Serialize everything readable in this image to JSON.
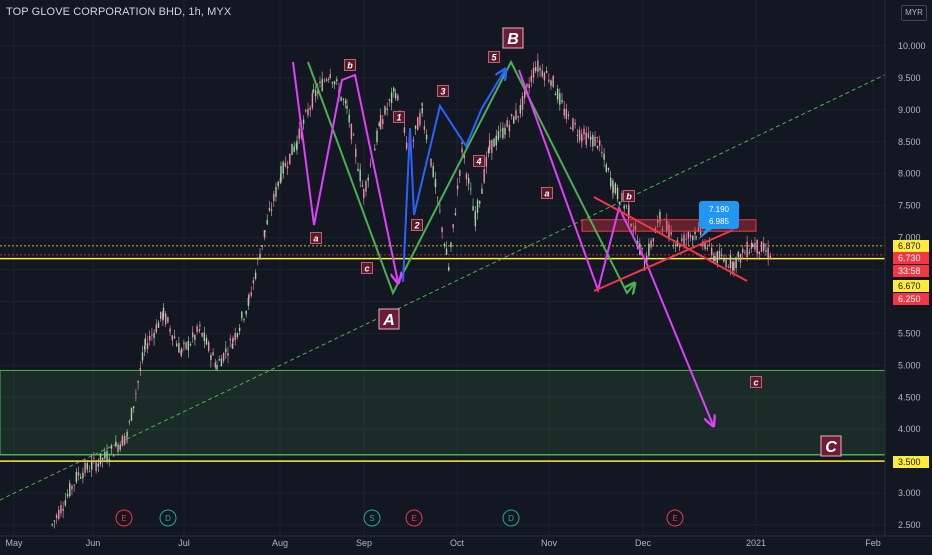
{
  "header": {
    "symbol_line": "TOP GLOVE CORPORATION BHD, 1h, MYX",
    "currency": "MYR"
  },
  "colors": {
    "background": "#131722",
    "candle_up": "#a5d6a7",
    "candle_down": "#f48fb1",
    "magenta": "#e040fb",
    "green": "#4caf50",
    "blue": "#2962ff",
    "red": "#f23645",
    "yellow": "#ffeb3b"
  },
  "chart_data": {
    "type": "candlestick",
    "x_tick_labels": [
      "May",
      "Jun",
      "Jul",
      "Aug",
      "Sep",
      "Oct",
      "Nov",
      "Dec",
      "2021",
      "Feb"
    ],
    "y_tick_labels": [
      "10.000",
      "9.500",
      "9.000",
      "8.500",
      "8.000",
      "7.500",
      "7.000",
      "6.500",
      "6.000",
      "5.500",
      "5.000",
      "4.500",
      "4.000",
      "3.500",
      "3.000",
      "2.500"
    ],
    "y_range": [
      2.5,
      10.0
    ],
    "price_path": [
      [
        "May",
        2.5
      ],
      [
        "May",
        3.3
      ],
      [
        "May",
        3.55
      ],
      [
        "Jun",
        3.9
      ],
      [
        "Jun",
        5.3
      ],
      [
        "Jun",
        5.8
      ],
      [
        "Jun",
        5.2
      ],
      [
        "Jun",
        5.55
      ],
      [
        "Jul",
        5.0
      ],
      [
        "Jul",
        5.4
      ],
      [
        "Jul",
        6.0
      ],
      [
        "Jul",
        7.1
      ],
      [
        "Jul",
        8.0
      ],
      [
        "Jul",
        8.5
      ],
      [
        "Aug",
        9.2
      ],
      [
        "Aug",
        9.6
      ],
      [
        "Aug",
        9.0
      ],
      [
        "Aug",
        7.7
      ],
      [
        "Aug",
        8.8
      ],
      [
        "Sep",
        9.3
      ],
      [
        "Sep",
        8.3
      ],
      [
        "Sep",
        9.0
      ],
      [
        "Sep",
        7.8
      ],
      [
        "Sep",
        6.5
      ],
      [
        "Sep",
        8.4
      ],
      [
        "Sep",
        7.3
      ],
      [
        "Oct",
        8.4
      ],
      [
        "Oct",
        8.7
      ],
      [
        "Oct",
        9.0
      ],
      [
        "Oct",
        9.7
      ],
      [
        "Oct",
        9.5
      ],
      [
        "Oct",
        8.9
      ],
      [
        "Nov",
        8.6
      ],
      [
        "Nov",
        8.5
      ],
      [
        "Nov",
        7.8
      ],
      [
        "Nov",
        7.4
      ],
      [
        "Nov",
        6.6
      ],
      [
        "Nov",
        7.3
      ],
      [
        "Dec",
        6.9
      ],
      [
        "Dec",
        7.1
      ],
      [
        "Dec",
        6.7
      ],
      [
        "Dec",
        6.6
      ],
      [
        "Dec",
        6.9
      ],
      [
        "Dec",
        6.73
      ]
    ],
    "last_price_label": "6.730",
    "countdown_label": "33:58",
    "price_level_labels": [
      {
        "text": "6.870",
        "bg": "#ffeb3b",
        "fg": "#131722",
        "value": 6.87
      },
      {
        "text": "6.730",
        "bg": "#f23645",
        "fg": "#ffffff",
        "value": 6.73
      },
      {
        "text": "6.670",
        "bg": "#ffeb3b",
        "fg": "#131722",
        "value": 6.67
      },
      {
        "text": "6.250",
        "bg": "#f23645",
        "fg": "#ffffff",
        "value": 6.25
      },
      {
        "text": "3.500",
        "bg": "#ffeb3b",
        "fg": "#131722",
        "value": 3.5
      }
    ],
    "horizontal_levels": [
      6.87,
      6.67,
      3.5,
      3.6
    ],
    "support_zone": [
      3.6,
      4.92
    ],
    "resistance_box": {
      "start": "Nov",
      "end": "2021",
      "range": [
        7.1,
        7.28
      ]
    },
    "callout_values": [
      "7.190",
      "6.985"
    ],
    "wave_labels": [
      {
        "text": "B",
        "style": "big",
        "month": "Oct",
        "value": 10.2
      },
      {
        "text": "A",
        "style": "big",
        "month": "Sep",
        "value": 6.0
      },
      {
        "text": "C",
        "style": "big",
        "month": "2021",
        "value": 3.7
      },
      {
        "text": "5",
        "month": "Oct",
        "value": 9.8
      },
      {
        "text": "b",
        "month": "Aug",
        "value": 9.65
      },
      {
        "text": "3",
        "month": "Sep",
        "value": 9.3
      },
      {
        "text": "1",
        "month": "Sep",
        "value": 8.9
      },
      {
        "text": "4",
        "month": "Oct",
        "value": 8.2
      },
      {
        "text": "a",
        "month": "Aug",
        "value": 7.1
      },
      {
        "text": "2",
        "month": "Sep",
        "value": 7.3
      },
      {
        "text": "c",
        "month": "Sep",
        "value": 6.85
      },
      {
        "text": "a",
        "month": "Nov",
        "value": 7.8
      },
      {
        "text": "b",
        "month": "Nov",
        "value": 7.7
      },
      {
        "text": "c",
        "month": "Dec",
        "value": 4.8
      }
    ],
    "event_markers": [
      {
        "text": "E",
        "kind": "earnings"
      },
      {
        "text": "D",
        "kind": "dividend"
      },
      {
        "text": "S",
        "kind": "split"
      },
      {
        "text": "E",
        "kind": "earnings"
      },
      {
        "text": "D",
        "kind": "dividend"
      },
      {
        "text": "E",
        "kind": "earnings"
      }
    ]
  }
}
